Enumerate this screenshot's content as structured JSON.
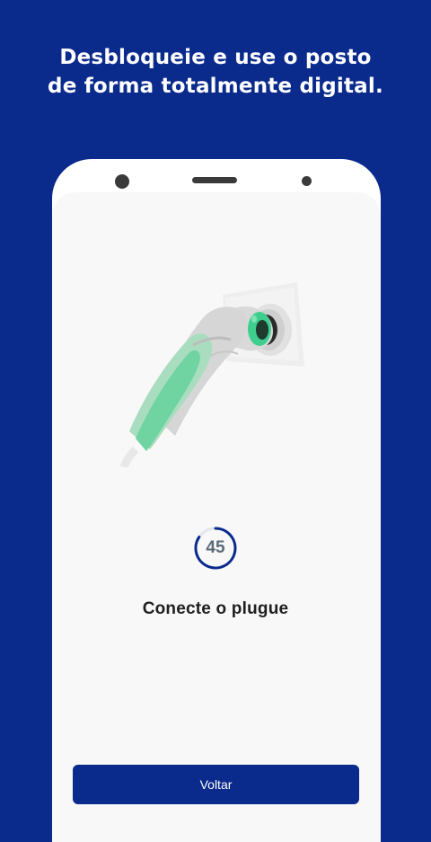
{
  "headline": {
    "line1": "Desbloqueie e use o posto",
    "line2": "de forma totalmente digital."
  },
  "timer": {
    "value": "45"
  },
  "step": {
    "label": "Conecte o plugue"
  },
  "actions": {
    "back_label": "Voltar"
  },
  "colors": {
    "background": "#0a2a8c",
    "accent_green": "#3ecf8e",
    "button": "#0a2a8c"
  },
  "icons": {
    "illustration": "ev-charging-plug-illustration",
    "timer": "countdown-ring-icon"
  }
}
